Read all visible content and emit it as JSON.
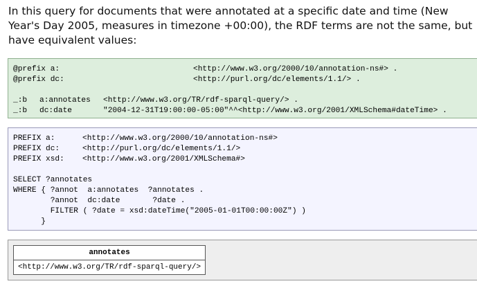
{
  "intro": "In this query for documents that were annotated at a specific date and time (New Year's Day 2005, measures in timezone +00:00), the RDF terms are not the same, but have equivalent values:",
  "data_block": {
    "lines": [
      {
        "a": "@prefix a:",
        "b": "",
        "c": "<http://www.w3.org/2000/10/annotation-ns#> ."
      },
      {
        "a": "@prefix dc:",
        "b": "",
        "c": "<http://purl.org/dc/elements/1.1/> ."
      },
      {
        "a": "_:b",
        "b": "a:annotates",
        "c": "<http://www.w3.org/TR/rdf-sparql-query/> ."
      },
      {
        "a": "_:b",
        "b": "dc:date",
        "c": "\"2004-12-31T19:00:00-05:00\"^^<http://www.w3.org/2001/XMLSchema#dateTime> ."
      }
    ]
  },
  "query_block": {
    "prefixes": [
      {
        "k": "PREFIX a:",
        "v": "<http://www.w3.org/2000/10/annotation-ns#>"
      },
      {
        "k": "PREFIX dc:",
        "v": "<http://purl.org/dc/elements/1.1/>"
      },
      {
        "k": "PREFIX xsd:",
        "v": "<http://www.w3.org/2001/XMLSchema#>"
      }
    ],
    "body": [
      "SELECT ?annotates",
      "WHERE { ?annot  a:annotates  ?annotates .",
      "        ?annot  dc:date       ?date .",
      "        FILTER ( ?date = xsd:dateTime(\"2005-01-01T00:00:00Z\") )",
      "      }"
    ]
  },
  "result_table": {
    "header": "annotates",
    "rows": [
      "<http://www.w3.org/TR/rdf-sparql-query/>"
    ]
  }
}
